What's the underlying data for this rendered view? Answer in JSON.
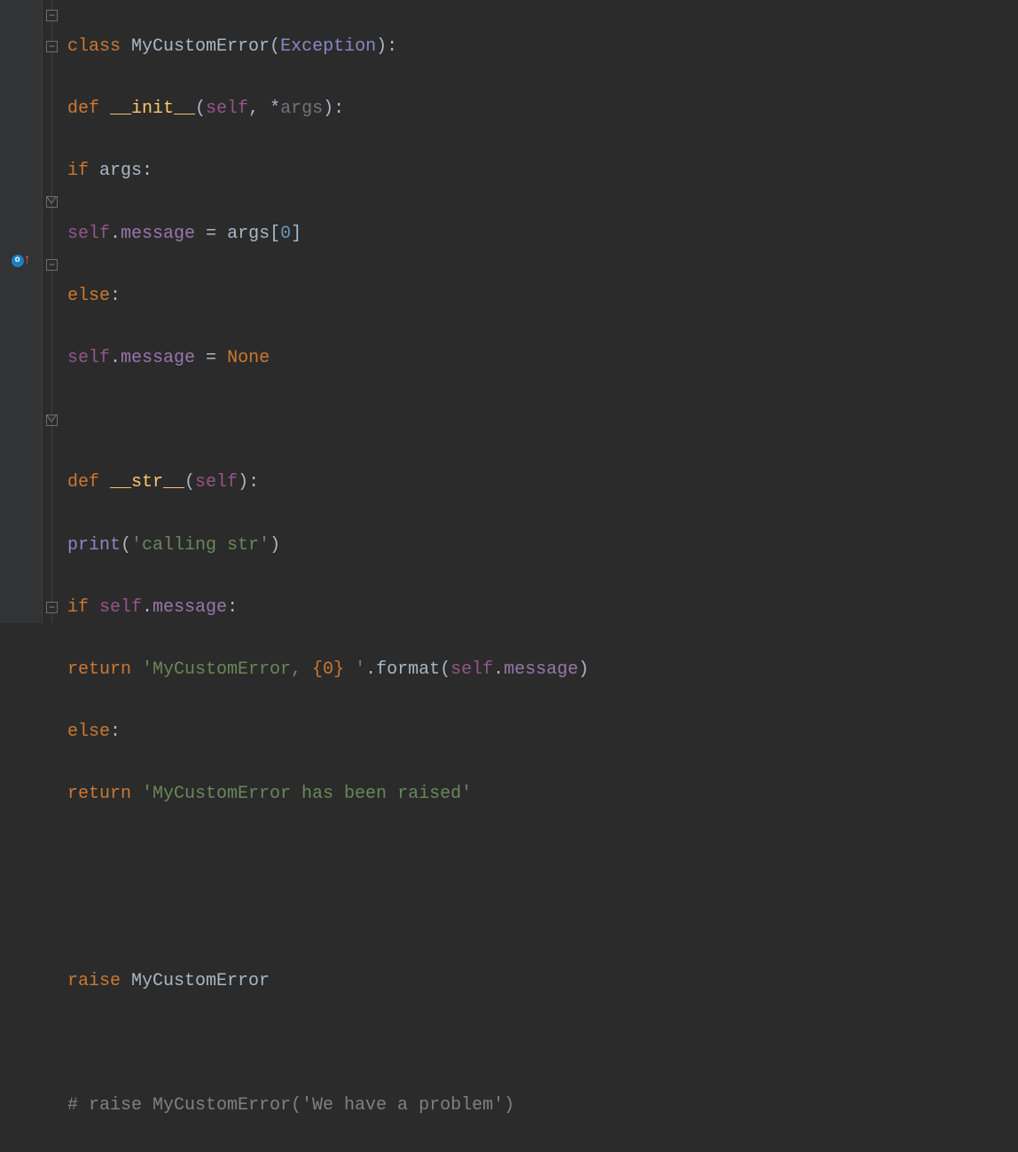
{
  "code": {
    "l1": {
      "class": "class ",
      "name": "MyCustomError",
      "paren_open": "(",
      "base": "Exception",
      "paren_close_colon": "):"
    },
    "l2": {
      "def": "def ",
      "name": "__init__",
      "paren_open": "(",
      "self": "self",
      "comma": ", *",
      "args": "args",
      "paren_close_colon": "):"
    },
    "l3": {
      "if": "if ",
      "args": "args",
      "colon": ":"
    },
    "l4": {
      "self": "self",
      "dot": ".",
      "attr": "message ",
      "eq": "= ",
      "args": "args",
      "bracket_open": "[",
      "zero": "0",
      "bracket_close": "]"
    },
    "l5": {
      "else": "else",
      "colon": ":"
    },
    "l6": {
      "self": "self",
      "dot": ".",
      "attr": "message ",
      "eq": "= ",
      "none": "None"
    },
    "l8": {
      "def": "def ",
      "name": "__str__",
      "paren_open": "(",
      "self": "self",
      "paren_close_colon": "):"
    },
    "l9": {
      "print": "print",
      "paren_open": "(",
      "string": "'calling str'",
      "paren_close": ")"
    },
    "l10": {
      "if": "if ",
      "self": "self",
      "dot": ".",
      "attr": "message",
      "colon": ":"
    },
    "l11": {
      "return": "return ",
      "string": "'MyCustomError, ",
      "brace": "{0}",
      "string_end": " '",
      "dot": ".",
      "format": "format",
      "paren_open": "(",
      "self": "self",
      "dot2": ".",
      "attr": "message",
      "paren_close": ")"
    },
    "l12": {
      "else": "else",
      "colon": ":"
    },
    "l13": {
      "return": "return ",
      "string": "'MyCustomError has been raised'"
    },
    "l16": {
      "raise": "raise ",
      "name": "MyCustomError"
    },
    "l18": {
      "comment": "# raise MyCustomError('We have a problem')"
    }
  },
  "icons": {
    "override": "o",
    "arrow": "↑"
  }
}
